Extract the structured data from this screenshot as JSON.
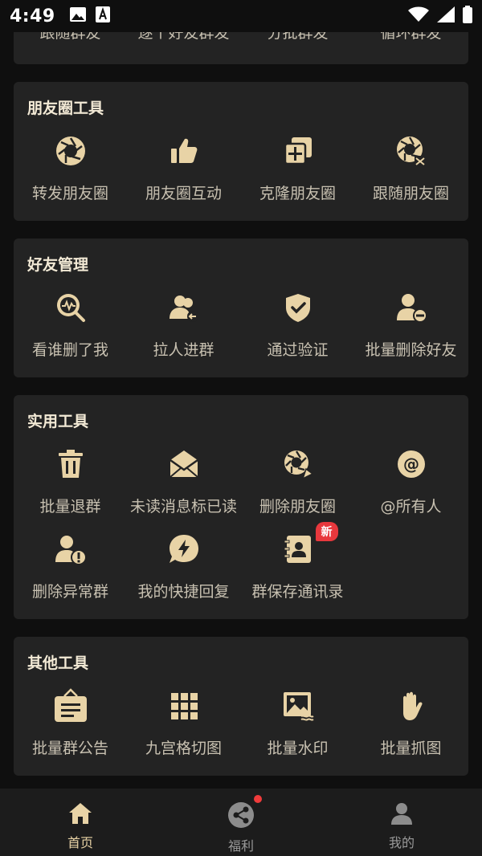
{
  "status_bar": {
    "time": "4:49"
  },
  "colors": {
    "gold": "#e8d3a6",
    "card": "#232323",
    "bg": "#0f0f0f",
    "badge": "#e8383d"
  },
  "top_card": {
    "items": [
      {
        "label": "跟随群友"
      },
      {
        "label": "逐个好友群发"
      },
      {
        "label": "分批群发"
      },
      {
        "label": "循环群发"
      }
    ]
  },
  "moments_tools": {
    "title": "朋友圈工具",
    "items": [
      {
        "label": "转发朋友圈",
        "icon": "aperture-icon"
      },
      {
        "label": "朋友圈互动",
        "icon": "thumbs-up-icon"
      },
      {
        "label": "克隆朋友圈",
        "icon": "clone-icon"
      },
      {
        "label": "跟随朋友圈",
        "icon": "aperture-shuffle-icon"
      }
    ]
  },
  "friend_mgmt": {
    "title": "好友管理",
    "items": [
      {
        "label": "看谁删了我",
        "icon": "magnifier-pulse-icon"
      },
      {
        "label": "拉人进群",
        "icon": "users-add-icon"
      },
      {
        "label": "通过验证",
        "icon": "shield-check-icon"
      },
      {
        "label": "批量删除好友",
        "icon": "user-remove-icon"
      }
    ]
  },
  "utility_tools": {
    "title": "实用工具",
    "items": [
      {
        "label": "批量退群",
        "icon": "trash-icon"
      },
      {
        "label": "未读消息标已读",
        "icon": "envelope-icon"
      },
      {
        "label": "删除朋友圈",
        "icon": "aperture-broom-icon"
      },
      {
        "label": "@所有人",
        "icon": "at-icon"
      },
      {
        "label": "删除异常群",
        "icon": "user-warning-icon"
      },
      {
        "label": "我的快捷回复",
        "icon": "lightning-bubble-icon"
      },
      {
        "label": "群保存通讯录",
        "icon": "contact-book-icon",
        "badge": "新"
      }
    ]
  },
  "other_tools": {
    "title": "其他工具",
    "items": [
      {
        "label": "批量群公告",
        "icon": "notice-board-icon"
      },
      {
        "label": "九宫格切图",
        "icon": "grid-icon"
      },
      {
        "label": "批量水印",
        "icon": "image-watermark-icon"
      },
      {
        "label": "批量抓图",
        "icon": "hand-icon"
      }
    ]
  },
  "tab_bar": {
    "tabs": [
      {
        "label": "首页",
        "active": true
      },
      {
        "label": "福利",
        "active": false
      },
      {
        "label": "我的",
        "active": false
      }
    ]
  }
}
